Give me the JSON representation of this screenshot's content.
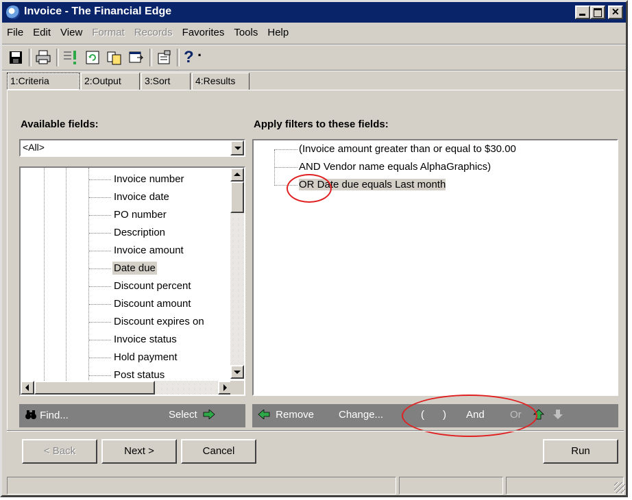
{
  "window": {
    "title": "Invoice - The Financial Edge"
  },
  "menu": [
    "File",
    "Edit",
    "View",
    "Format",
    "Records",
    "Favorites",
    "Tools",
    "Help"
  ],
  "menu_disabled": [
    "Format",
    "Records"
  ],
  "toolbar": {
    "help_glyph": "?",
    "help_dropdown": "·"
  },
  "tabs": [
    "1:Criteria",
    "2:Output",
    "3:Sort",
    "4:Results"
  ],
  "left": {
    "heading": "Available fields:",
    "combo_value": "<All>",
    "fields": [
      "Invoice number",
      "Invoice date",
      "PO number",
      "Description",
      "Invoice amount",
      "Date due",
      "Discount percent",
      "Discount amount",
      "Discount expires on",
      "Invoice status",
      "Hold payment",
      "Post status"
    ],
    "selected_field": "Date due"
  },
  "right": {
    "heading": "Apply filters to these fields:",
    "filters": [
      "(Invoice amount greater than or equal to $30.00",
      "AND Vendor name equals AlphaGraphics)",
      "OR Date due equals Last month"
    ]
  },
  "left_actions": {
    "find": "Find...",
    "select": "Select"
  },
  "right_actions": {
    "remove": "Remove",
    "change": "Change...",
    "open_paren": "(",
    "close_paren": ")",
    "and": "And",
    "or": "Or"
  },
  "buttons": {
    "back": "< Back",
    "next": "Next >",
    "cancel": "Cancel",
    "run": "Run"
  },
  "colors": {
    "title_bar": "#0a246a",
    "face": "#d4d0c8",
    "action_bar": "#808080",
    "arrow_green": "#2fa84a",
    "annotation_red": "#e02020"
  }
}
